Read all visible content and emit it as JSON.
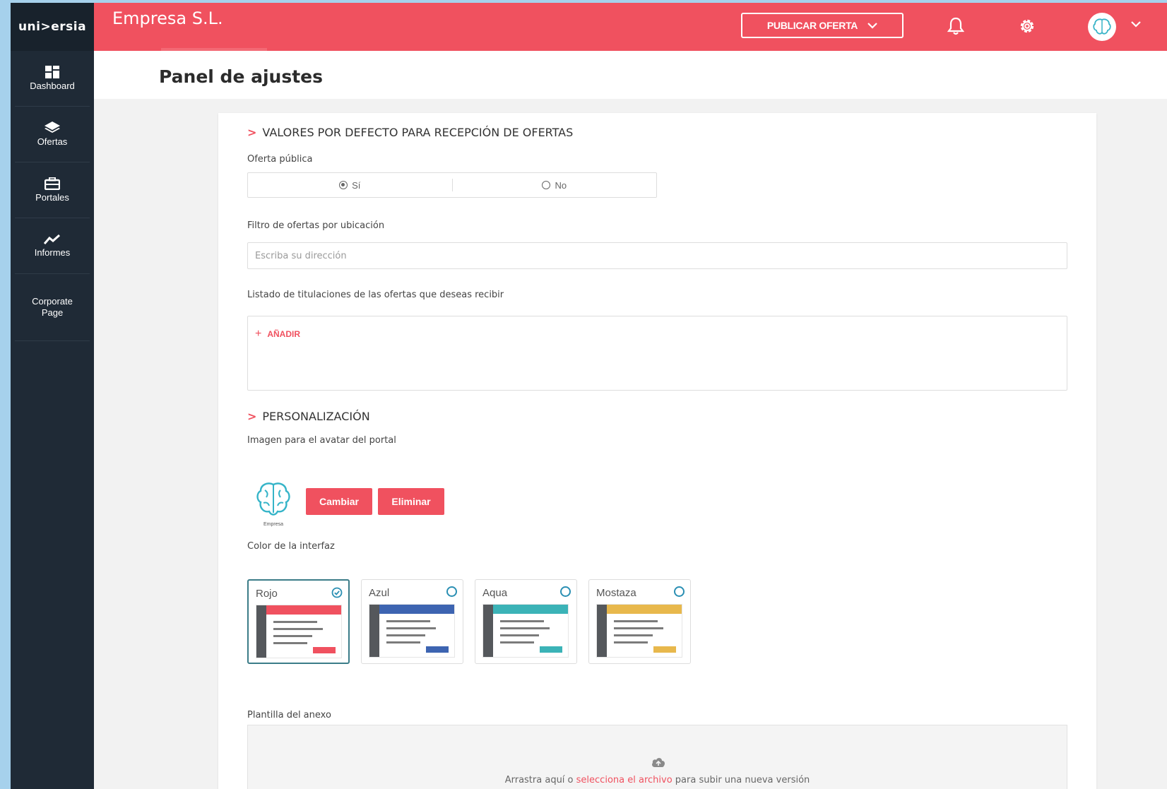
{
  "brand": {
    "logo_text": "uni>ersia",
    "accent": "#f0515f",
    "sidebar_bg": "#1f2a36"
  },
  "sidebar": {
    "items": [
      {
        "label": "Dashboard",
        "icon": "dashboard-icon"
      },
      {
        "label": "Ofertas",
        "icon": "layers-icon"
      },
      {
        "label": "Portales",
        "icon": "briefcase-icon"
      },
      {
        "label": "Informes",
        "icon": "chart-line-icon"
      },
      {
        "label": "Corporate Page",
        "icon": ""
      }
    ]
  },
  "topbar": {
    "company": "Empresa S.L.",
    "publish_label": "PUBLICAR OFERTA",
    "icons": [
      "bell-icon",
      "gear-icon",
      "avatar",
      "chevron-down-icon"
    ]
  },
  "page": {
    "title": "Panel de ajustes"
  },
  "section_defaults": {
    "title": "VALORES POR DEFECTO PARA RECEPCIÓN DE OFERTAS",
    "oferta_publica_label": "Oferta pública",
    "options": [
      "Sí",
      "No"
    ],
    "selected": "Sí",
    "filtro_label": "Filtro de ofertas por ubicación",
    "filtro_placeholder": "Escriba su dirección",
    "titulaciones_label": "Listado de titulaciones de las ofertas que deseas recibir",
    "add_label": "AÑADIR"
  },
  "section_custom": {
    "title": "PERSONALIZACIÓN",
    "avatar_label": "Imagen para el avatar del portal",
    "avatar_caption": "Empresa",
    "change_label": "Cambiar",
    "delete_label": "Eliminar",
    "color_label": "Color de la interfaz",
    "colors": [
      {
        "name": "Rojo",
        "hex": "#f0515f",
        "selected": true
      },
      {
        "name": "Azul",
        "hex": "#3d64b1",
        "selected": false
      },
      {
        "name": "Aqua",
        "hex": "#3bb3b7",
        "selected": false
      },
      {
        "name": "Mostaza",
        "hex": "#e8b84c",
        "selected": false
      }
    ],
    "template_label": "Plantilla del anexo",
    "upload_text_before": "Arrastra aquí o",
    "upload_link": "selecciona el archivo",
    "upload_text_after": "para subir una nueva versión"
  }
}
